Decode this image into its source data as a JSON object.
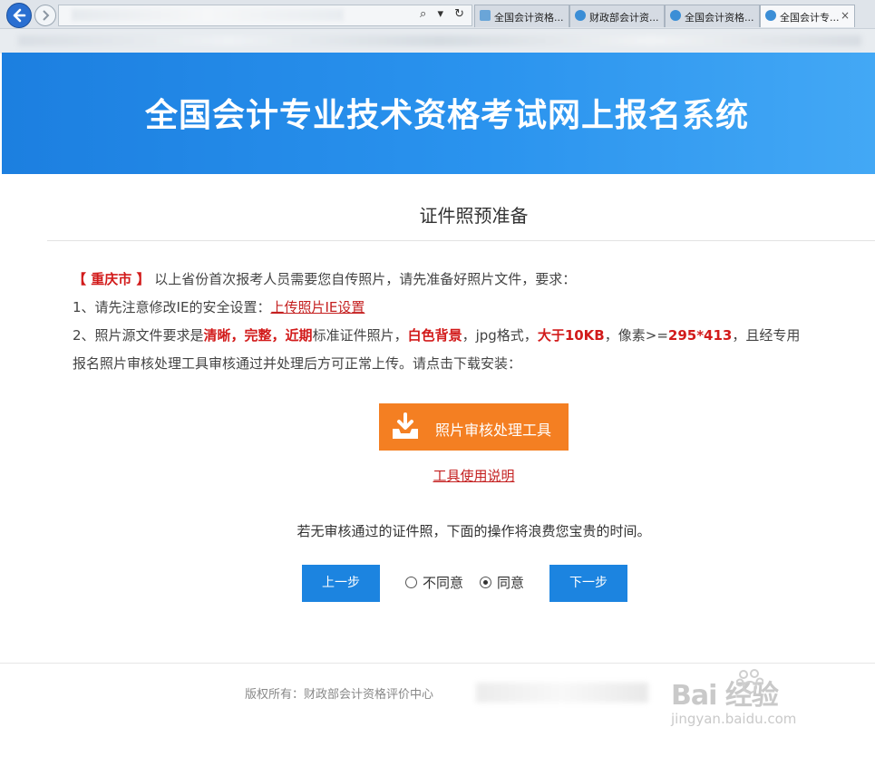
{
  "browser": {
    "tabs": [
      {
        "label": "全国会计资格...",
        "active": false
      },
      {
        "label": "财政部会计资...",
        "active": false
      },
      {
        "label": "全国会计资格...",
        "active": false
      },
      {
        "label": "全国会计专...",
        "active": true
      }
    ],
    "tab_close_glyph": "×",
    "address_icons": "⌕ ▾ ↻"
  },
  "banner": {
    "title": "全国会计专业技术资格考试网上报名系统"
  },
  "page": {
    "title": "证件照预准备",
    "intro": {
      "province": "【 重庆市 】",
      "text": "以上省份首次报考人员需要您自传照片，请先准备好照片文件，要求："
    },
    "req1": {
      "prefix": "1、请先注意修改IE的安全设置：",
      "link": "上传照片IE设置"
    },
    "req2": {
      "p1": "2、照片源文件要求是",
      "h1": "清晰，完整，近期",
      "p2": "标准证件照片，",
      "h2": "白色背景",
      "p3": "，jpg格式，",
      "h3": "大于10KB",
      "p4": "，像素>=",
      "h4": "295*413",
      "p5": "，且经专用",
      "line2": "报名照片审核处理工具审核通过并处理后方可正常上传。请点击下载安装："
    },
    "tool_button": "照片审核处理工具",
    "manual_link": "工具使用说明",
    "notice": "若无审核通过的证件照，下面的操作将浪费您宝贵的时间。",
    "prev_button": "上一步",
    "next_button": "下一步",
    "radio_disagree": "不同意",
    "radio_agree": "同意",
    "selected": "agree"
  },
  "footer": {
    "copyright": "版权所有：财政部会计资格评价中心"
  },
  "watermark": {
    "logo": "Bai  经验",
    "sub": "jingyan.baidu.com"
  },
  "colors": {
    "banner": "#1c7fe0",
    "highlight_red": "#d21b1b",
    "tool_orange": "#f47f22",
    "step_blue": "#1c84e0"
  }
}
